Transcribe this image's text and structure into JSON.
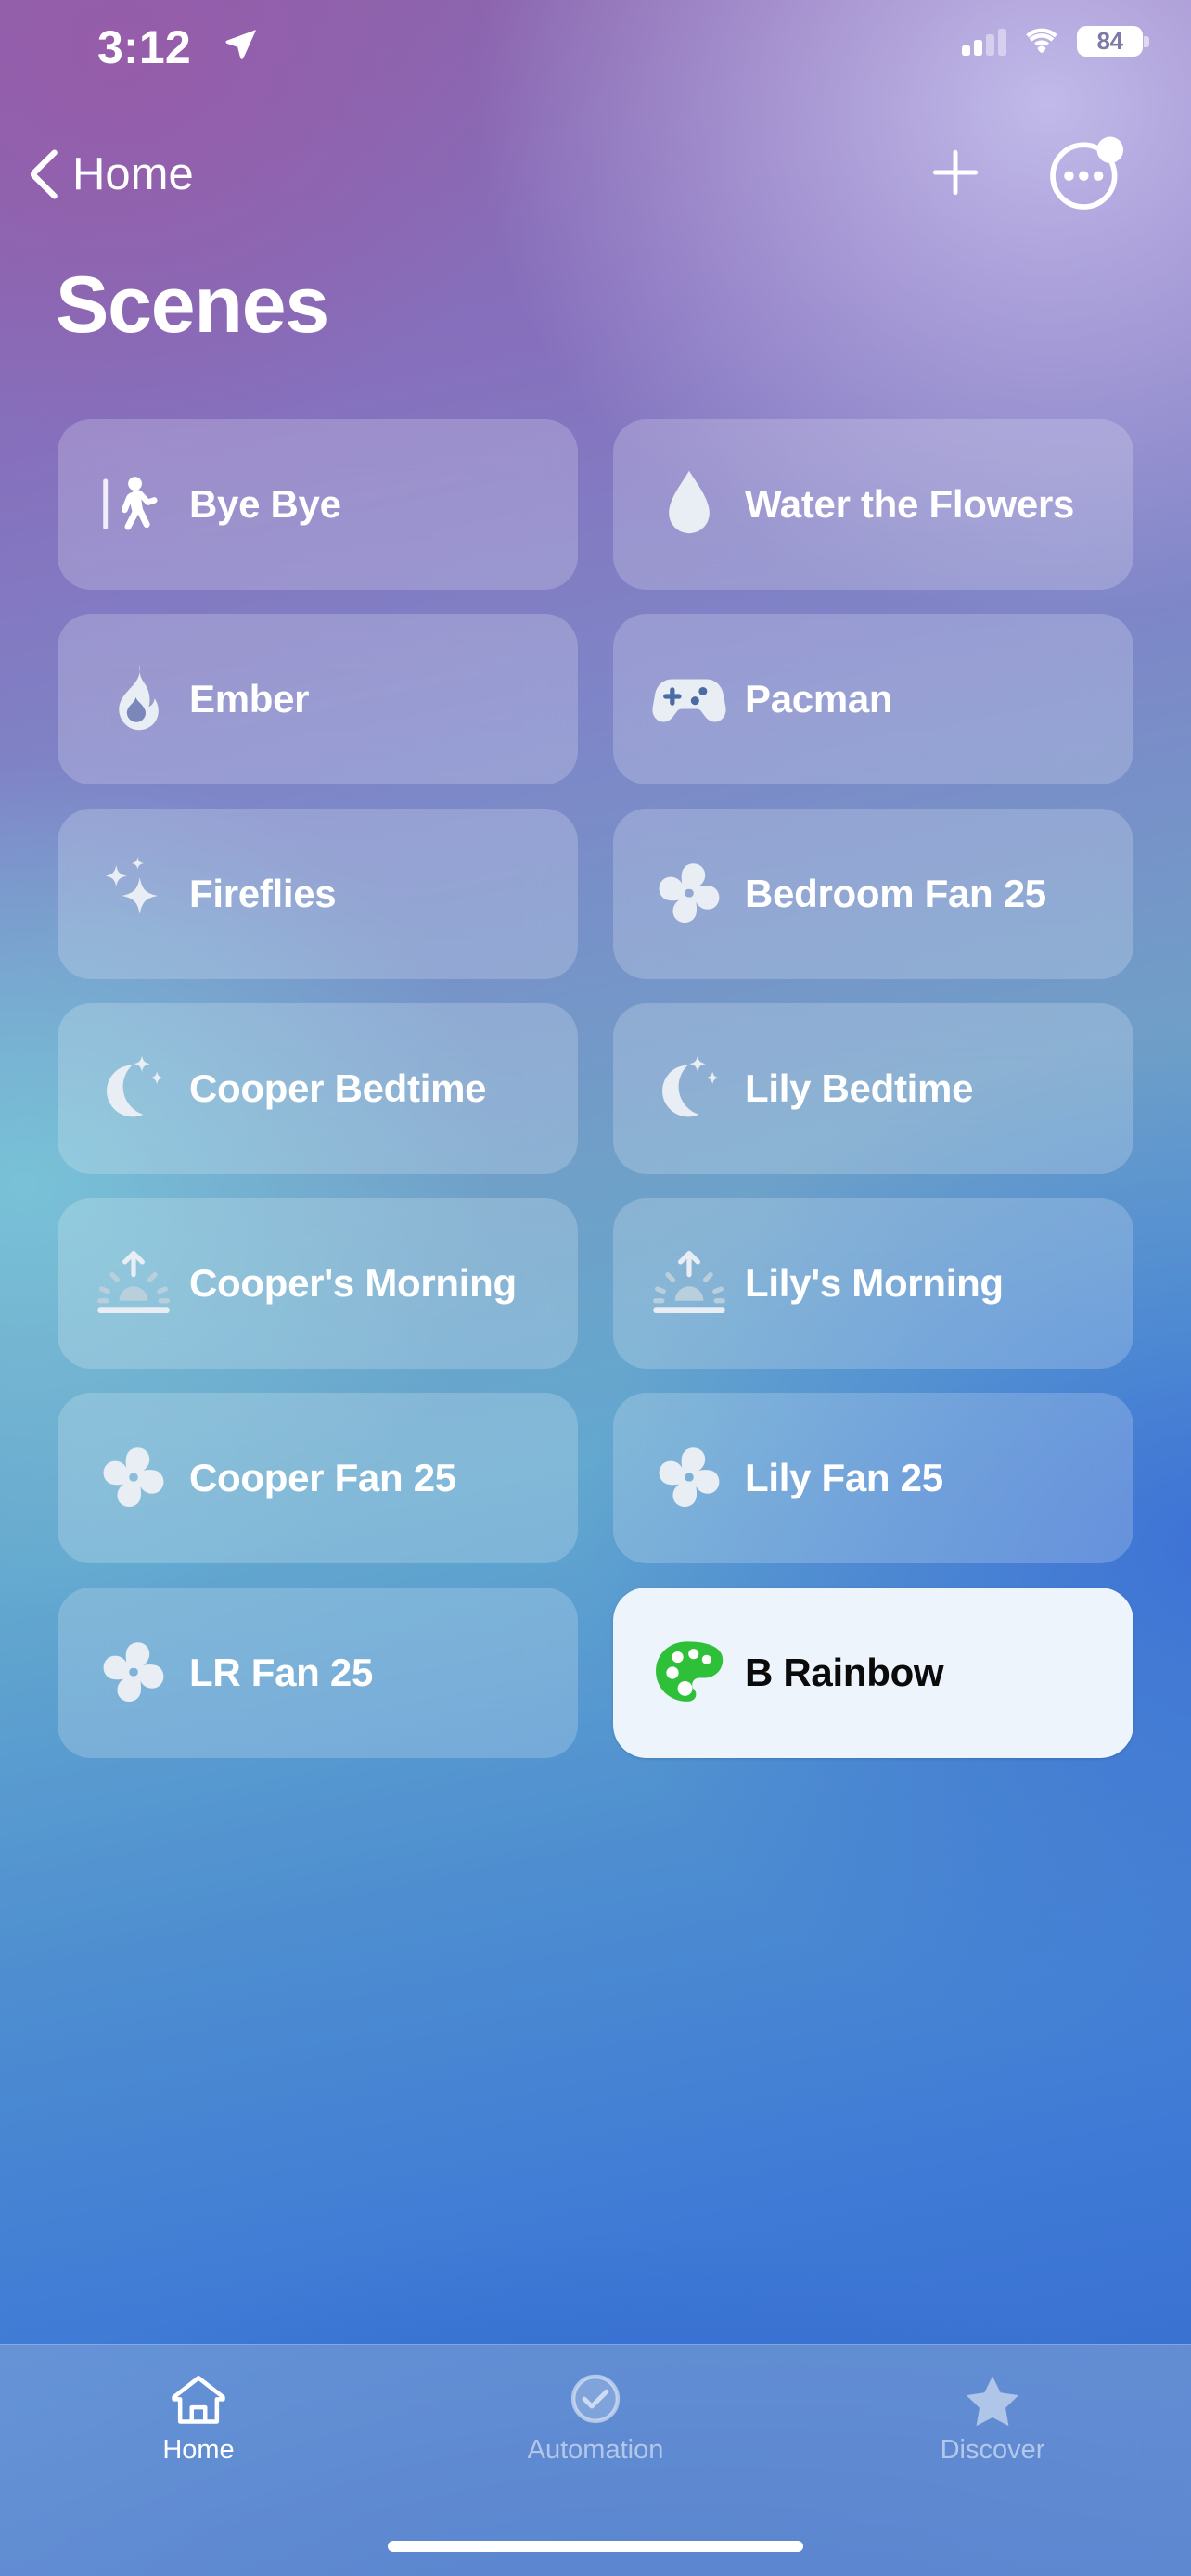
{
  "status_bar": {
    "time": "3:12",
    "location_icon": "location-arrow-icon",
    "cellular_icon": "cellular-signal-icon",
    "wifi_icon": "wifi-icon",
    "battery_level": "84"
  },
  "nav": {
    "back_label": "Home",
    "back_icon": "chevron-left-icon",
    "add_icon": "plus-icon",
    "more_icon": "ellipsis-circle-icon",
    "more_badge": true
  },
  "page": {
    "title": "Scenes"
  },
  "scenes": [
    {
      "label": "Bye Bye",
      "icon": "figure-walk-icon",
      "active": false
    },
    {
      "label": "Water the Flowers",
      "icon": "water-drop-icon",
      "active": false
    },
    {
      "label": "Ember",
      "icon": "flame-icon",
      "active": false
    },
    {
      "label": "Pacman",
      "icon": "gamepad-icon",
      "active": false
    },
    {
      "label": "Fireflies",
      "icon": "sparkles-icon",
      "active": false
    },
    {
      "label": "Bedroom Fan 25",
      "icon": "fan-icon",
      "active": false
    },
    {
      "label": "Cooper Bedtime",
      "icon": "moon-stars-icon",
      "active": false
    },
    {
      "label": "Lily Bedtime",
      "icon": "moon-stars-icon",
      "active": false
    },
    {
      "label": "Cooper's Morning",
      "icon": "sunrise-icon",
      "active": false
    },
    {
      "label": "Lily's Morning",
      "icon": "sunrise-icon",
      "active": false
    },
    {
      "label": "Cooper Fan 25",
      "icon": "fan-icon",
      "active": false
    },
    {
      "label": "Lily Fan 25",
      "icon": "fan-icon",
      "active": false
    },
    {
      "label": "LR Fan 25",
      "icon": "fan-icon",
      "active": false
    },
    {
      "label": "B Rainbow",
      "icon": "paint-palette-icon",
      "active": true
    }
  ],
  "tabs": [
    {
      "label": "Home",
      "icon": "house-icon",
      "selected": true
    },
    {
      "label": "Automation",
      "icon": "checkmark-clock-icon",
      "selected": false
    },
    {
      "label": "Discover",
      "icon": "star-icon",
      "selected": false
    }
  ],
  "colors": {
    "active_tile_bg": "#eef4fc",
    "active_tile_text": "#0b0b0b",
    "palette_icon": "#2fc039",
    "tile_text": "#ffffff"
  }
}
